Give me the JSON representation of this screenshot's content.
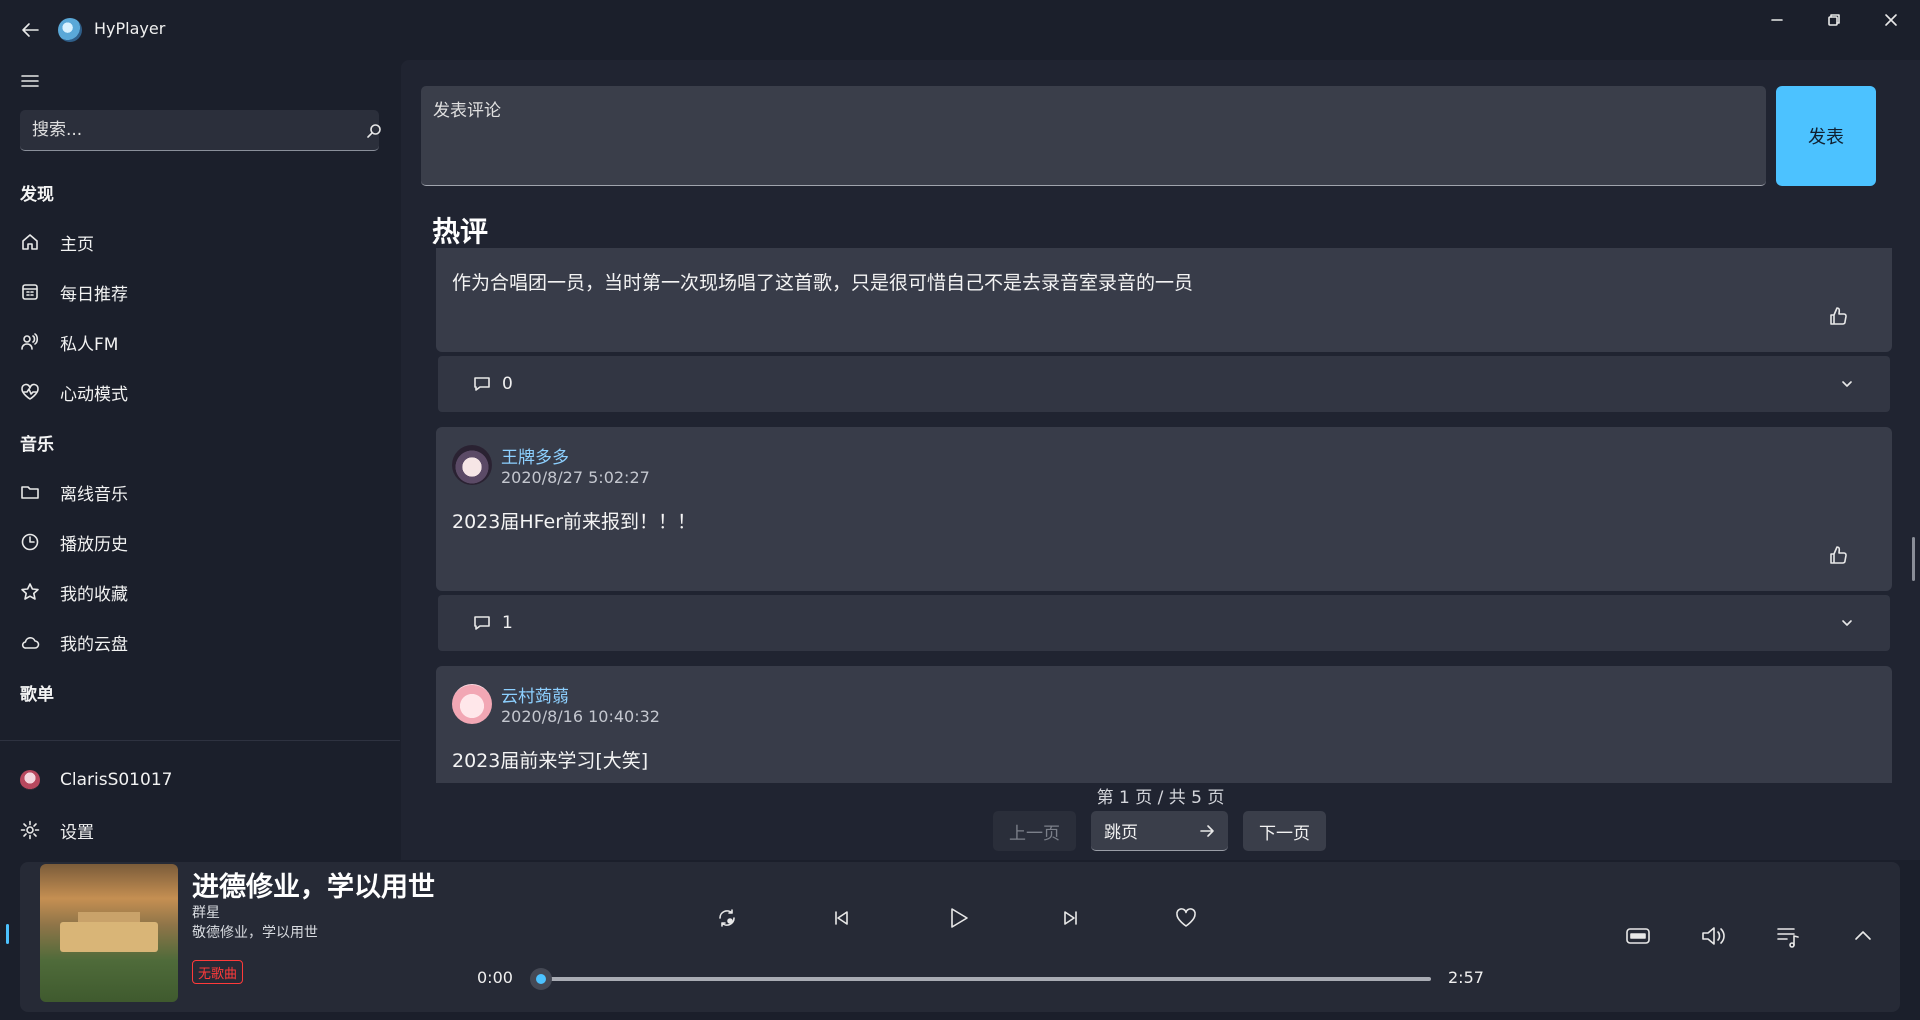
{
  "app": {
    "title": "HyPlayer"
  },
  "search": {
    "placeholder": "搜索..."
  },
  "nav": {
    "discover_section": "发现",
    "music_section": "音乐",
    "playlists_section": "歌单",
    "items": {
      "home": "主页",
      "daily": "每日推荐",
      "fm": "私人FM",
      "heartbeat": "心动模式",
      "local": "离线音乐",
      "history": "播放历史",
      "favorites": "我的收藏",
      "cloud": "我的云盘"
    },
    "user": "ClarisS01017",
    "settings": "设置"
  },
  "comment_form": {
    "placeholder": "发表评论",
    "submit_label": "发表"
  },
  "hot": {
    "title": "热评",
    "comments": [
      {
        "user": "",
        "time": "",
        "text": "作为合唱团一员，当时第一次现场唱了这首歌，只是很可惜自己不是去录音室录音的一员",
        "replies": "0"
      },
      {
        "user": "王牌多多",
        "time": "2020/8/27 5:02:27",
        "text": "2023届HFer前来报到！！！",
        "replies": "1"
      },
      {
        "user": "云村蒟蒻",
        "time": "2020/8/16 10:40:32",
        "text": "2023届前来学习[大笑]",
        "replies": ""
      }
    ]
  },
  "pagination": {
    "info": "第 1 页 / 共 5 页",
    "prev": "上一页",
    "jump": "跳页",
    "next": "下一页"
  },
  "player": {
    "song": "进德修业，学以用世",
    "artist": "群星",
    "album": "敬德修业，学以用世",
    "badge": "无歌曲",
    "current_time": "0:00",
    "total_time": "2:57",
    "progress": 0,
    "accent": "#4cc2ff"
  },
  "colors": {
    "accent": "#4cc2ff",
    "background": "#1b1f2b",
    "badge_red": "#ff3a3a",
    "username_blue": "#8dd0ff"
  }
}
